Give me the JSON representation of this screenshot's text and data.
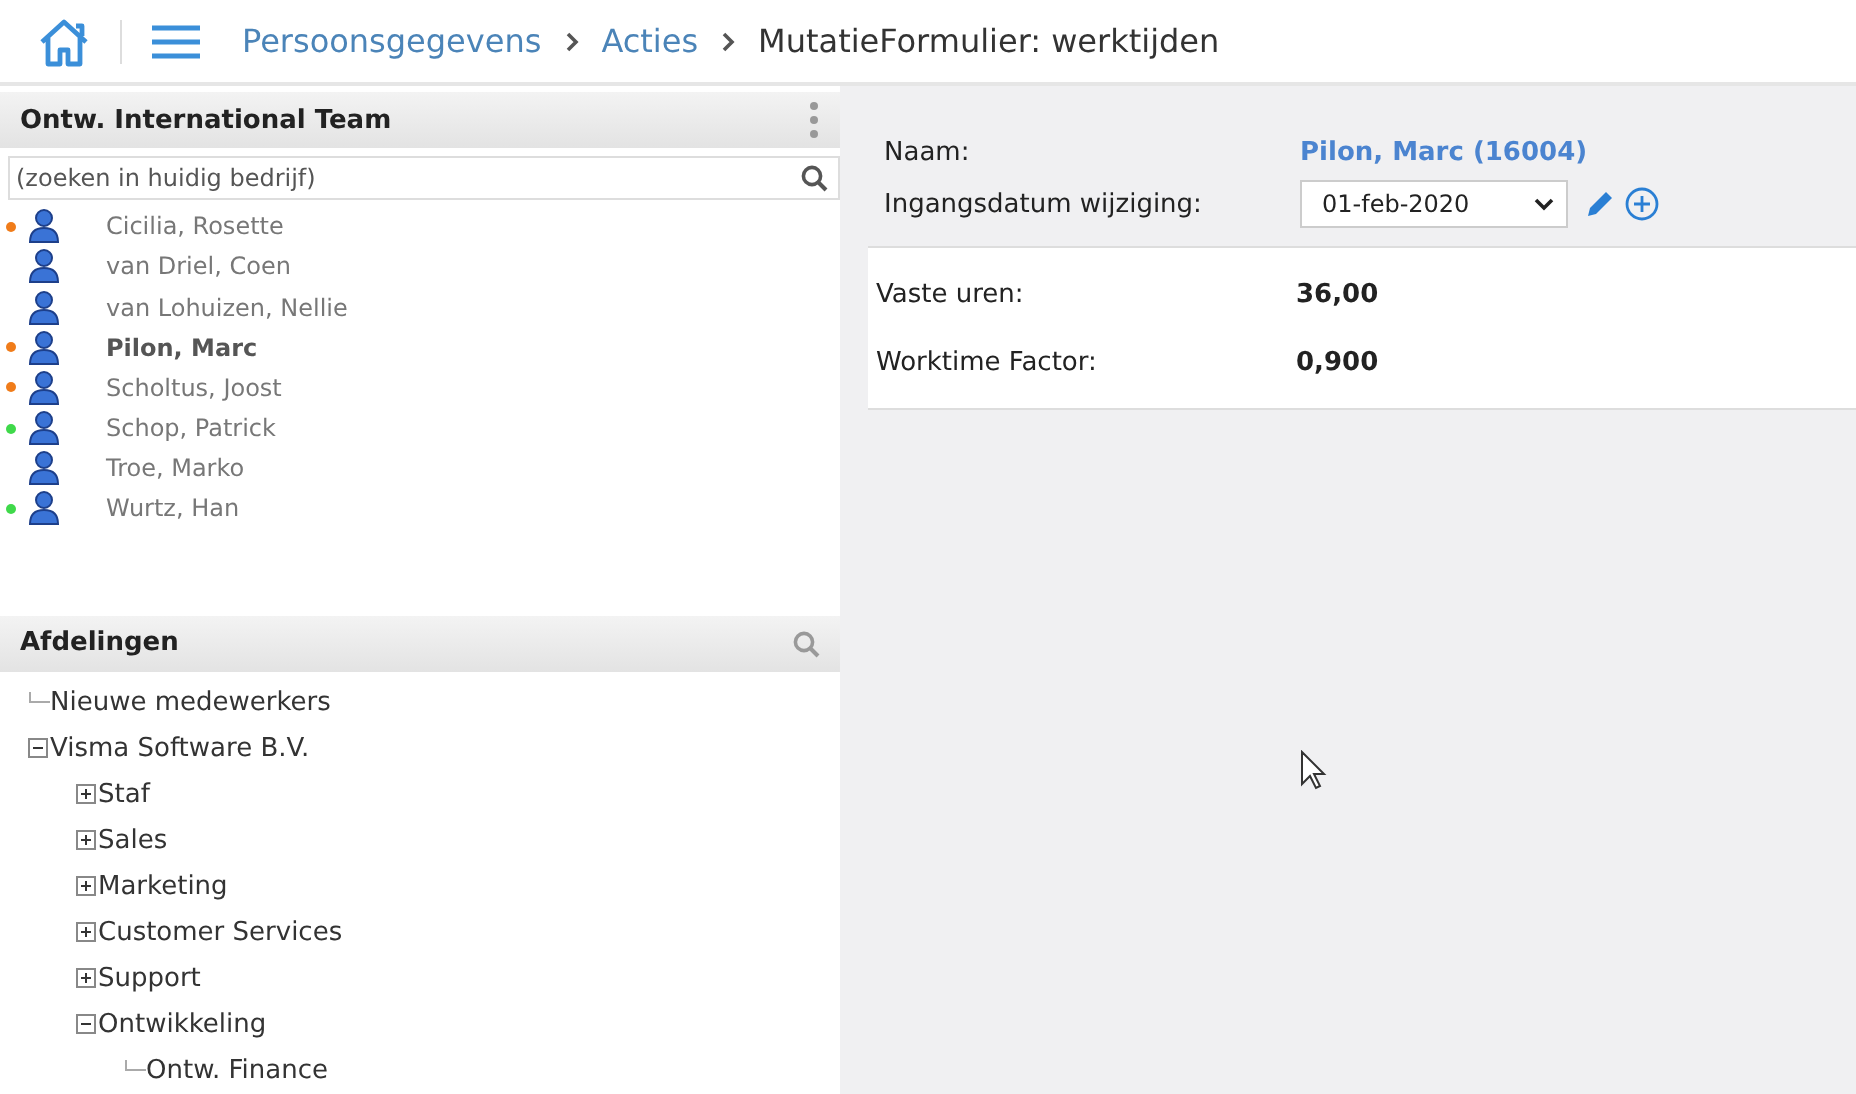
{
  "breadcrumb": [
    {
      "label": "Persoonsgegevens",
      "kind": "link"
    },
    {
      "label": "Acties",
      "kind": "link"
    },
    {
      "label": "MutatieFormulier: werktijden",
      "kind": "current"
    }
  ],
  "team_panel": {
    "title": "Ontw. International Team",
    "search": {
      "placeholder": "(zoeken in huidig bedrijf)"
    },
    "employees": [
      {
        "name": "Cicilia, Rosette",
        "color": "#f07c1a",
        "selected": false
      },
      {
        "name": "van Driel, Coen",
        "selected": false
      },
      {
        "name": "van Lohuizen, Nellie",
        "selected": false
      },
      {
        "name": "Pilon, Marc",
        "color": "#f07c1a",
        "selected": true
      },
      {
        "name": "Scholtus, Joost",
        "color": "#f07c1a",
        "selected": false
      },
      {
        "name": "Schop, Patrick",
        "color": "#3fd94a",
        "selected": false
      },
      {
        "name": "Troe, Marko",
        "selected": false
      },
      {
        "name": "Wurtz, Han",
        "color": "#3fd94a",
        "selected": false
      }
    ]
  },
  "departments_panel": {
    "title": "Afdelingen",
    "tree": [
      {
        "label": "Nieuwe medewerkers"
      },
      {
        "label": "Visma Software B.V.",
        "expanded": true,
        "children": [
          {
            "label": "Staf",
            "expanded": false
          },
          {
            "label": "Sales",
            "expanded": false
          },
          {
            "label": "Marketing",
            "expanded": false
          },
          {
            "label": "Customer Services",
            "expanded": false
          },
          {
            "label": "Support",
            "expanded": false
          },
          {
            "label": "Ontwikkeling",
            "expanded": true,
            "children": [
              {
                "label": "Ontw. Finance"
              }
            ]
          }
        ]
      }
    ]
  },
  "form": {
    "name_label": "Naam:",
    "name_value": "Pilon, Marc (16004)",
    "date_label": "Ingangsdatum wijziging:",
    "date_value": "01-feb-2020",
    "fields": [
      {
        "label": "Vaste uren:",
        "value": "36,00"
      },
      {
        "label": "Worktime Factor:",
        "value": "0,900"
      }
    ]
  }
}
